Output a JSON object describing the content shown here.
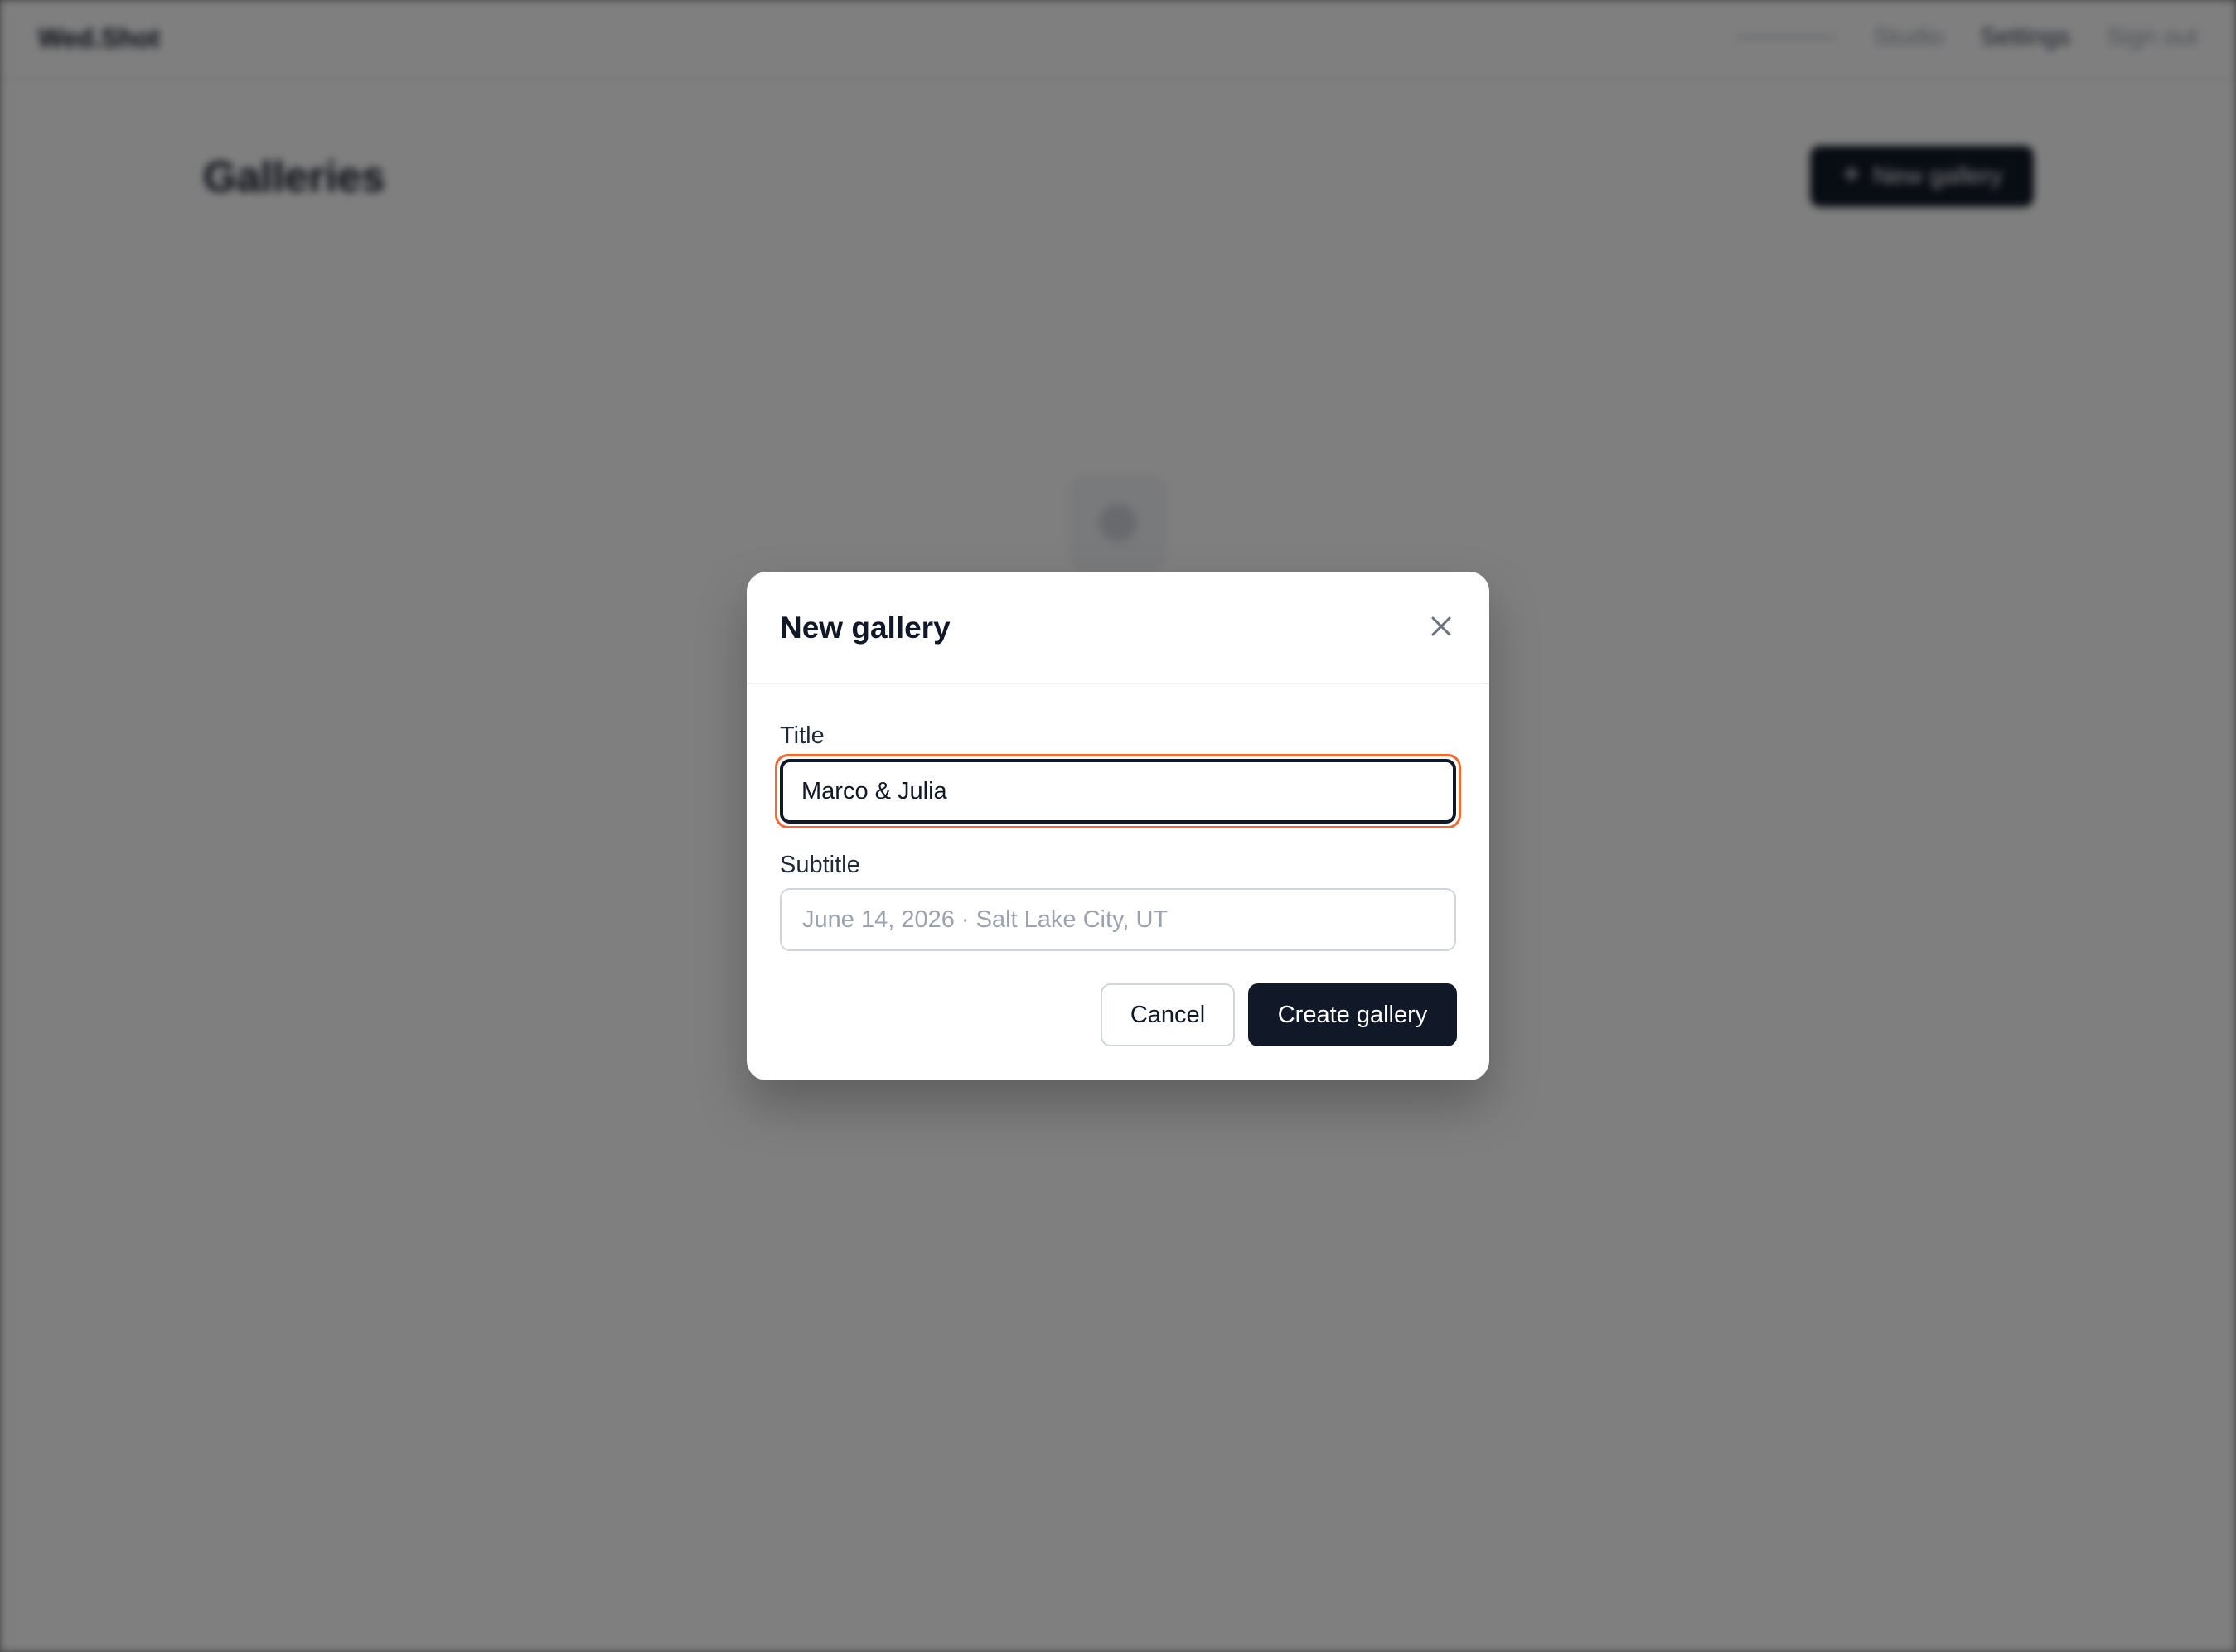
{
  "app": {
    "brand": "Wed.Shot",
    "nav": [
      "Studio",
      "Settings",
      "Sign out"
    ],
    "page_title": "Galleries",
    "new_gallery_button": "New gallery",
    "new_gallery_button_icon": "plus-icon",
    "empty_state_icon": "image-icon"
  },
  "modal": {
    "title": "New gallery",
    "close_icon": "close-icon",
    "fields": {
      "title": {
        "label": "Title",
        "value": "Marco & Julia"
      },
      "subtitle": {
        "label": "Subtitle",
        "placeholder": "June 14, 2026 · Salt Lake City, UT",
        "value": ""
      }
    },
    "cancel_label": "Cancel",
    "create_label": "Create gallery"
  },
  "colors": {
    "primary": "#111827",
    "focus_ring": "#f06a35",
    "overlay": "rgba(0,0,0,0.5)"
  }
}
